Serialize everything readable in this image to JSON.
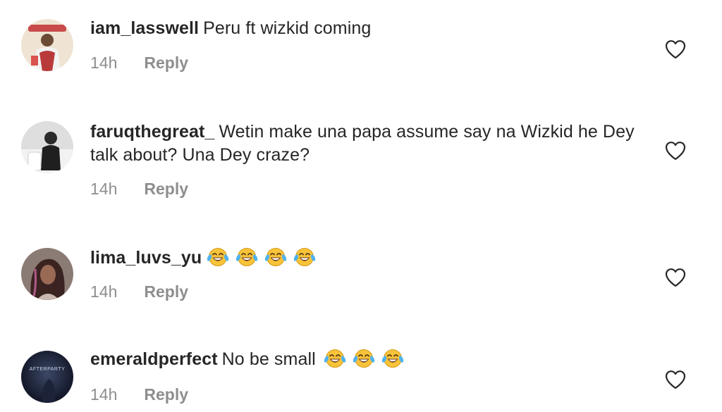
{
  "comments": [
    {
      "username": "iam_lasswell",
      "text": "Peru ft wizkid coming",
      "time": "14h",
      "reply_label": "Reply",
      "emoji_count": 0,
      "avatar_colors": {
        "bg": "#e9d9c2",
        "fg": "#b83a3a"
      }
    },
    {
      "username": "faruqthegreat_",
      "text": "Wetin make una papa assume say na Wizkid he Dey talk about? Una Dey craze?",
      "time": "14h",
      "reply_label": "Reply",
      "emoji_count": 0,
      "avatar_colors": {
        "bg": "#d9d9d9",
        "fg": "#1e1e1e"
      }
    },
    {
      "username": "lima_luvs_yu",
      "text": "",
      "time": "14h",
      "reply_label": "Reply",
      "emoji_count": 4,
      "avatar_colors": {
        "bg": "#7a6a66",
        "fg": "#2b1a17"
      }
    },
    {
      "username": "emeraldperfect",
      "text": "No be small",
      "time": "14h",
      "reply_label": "Reply",
      "emoji_count": 3,
      "avatar_overlay_text": "AFTERPARTY",
      "avatar_colors": {
        "bg": "#1a1f33",
        "fg": "#5a6a8a"
      }
    }
  ],
  "emoji_name": "face-with-tears-of-joy",
  "icons": {
    "like": "heart-outline-icon"
  },
  "colors": {
    "text": "#262626",
    "secondary": "#8e8e8e",
    "emoji_face": "#f7c33a",
    "emoji_tears": "#4fb3ee"
  }
}
